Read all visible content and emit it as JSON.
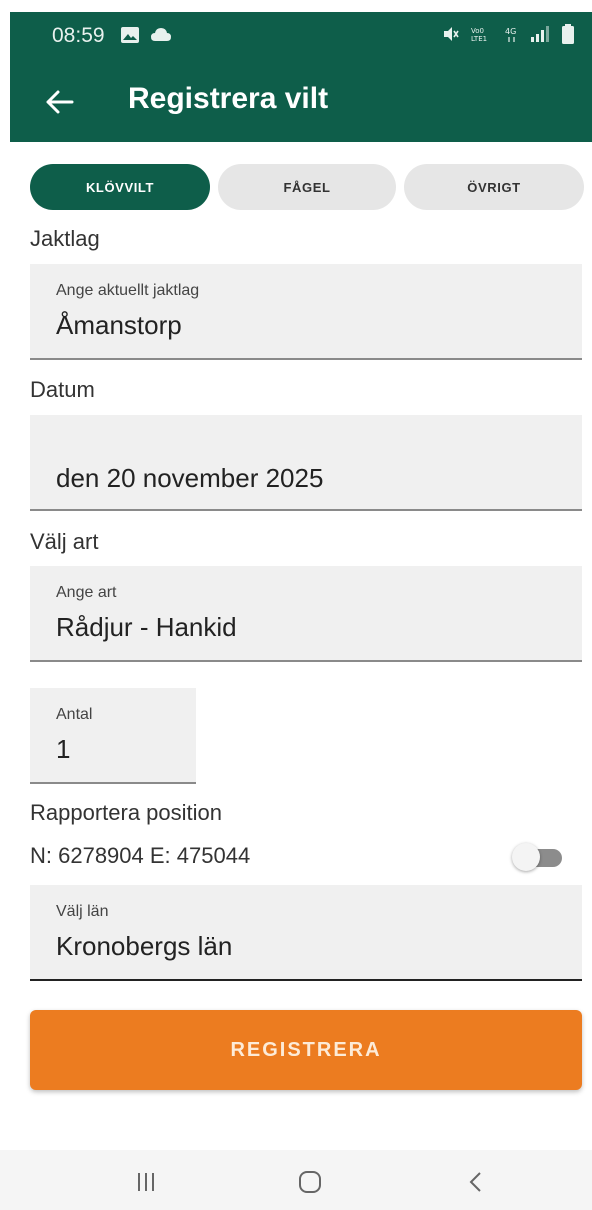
{
  "status_bar": {
    "time": "08:59",
    "left_icons": [
      "image-icon",
      "cloud-icon"
    ],
    "right_icons": [
      "mute-icon",
      "volte-icon",
      "network-4g-icon",
      "signal-icon",
      "battery-icon"
    ]
  },
  "app_bar": {
    "title": "Registrera vilt",
    "back_icon": "arrow-left-icon"
  },
  "tabs": [
    {
      "label": "KLÖVVILT",
      "active": true
    },
    {
      "label": "FÅGEL",
      "active": false
    },
    {
      "label": "ÖVRIGT",
      "active": false
    }
  ],
  "jaktlag": {
    "section_label": "Jaktlag",
    "field_label": "Ange aktuellt jaktlag",
    "value": "Åmanstorp"
  },
  "datum": {
    "section_label": "Datum",
    "value": "den 20 november 2025"
  },
  "art": {
    "section_label": "Välj art",
    "field_label": "Ange art",
    "value": "Rådjur - Hankid"
  },
  "antal": {
    "field_label": "Antal",
    "value": "1"
  },
  "position": {
    "label": "Rapportera position",
    "coords": "N: 6278904 E: 475044",
    "toggle_on": false
  },
  "lan": {
    "field_label": "Välj län",
    "value": "Kronobergs län"
  },
  "submit": {
    "label": "REGISTRERA",
    "color": "#ec7c20"
  },
  "colors": {
    "primary": "#0e5e4a",
    "accent": "#ec7c20"
  },
  "system_nav": [
    "recent-apps-icon",
    "home-icon",
    "back-icon"
  ]
}
